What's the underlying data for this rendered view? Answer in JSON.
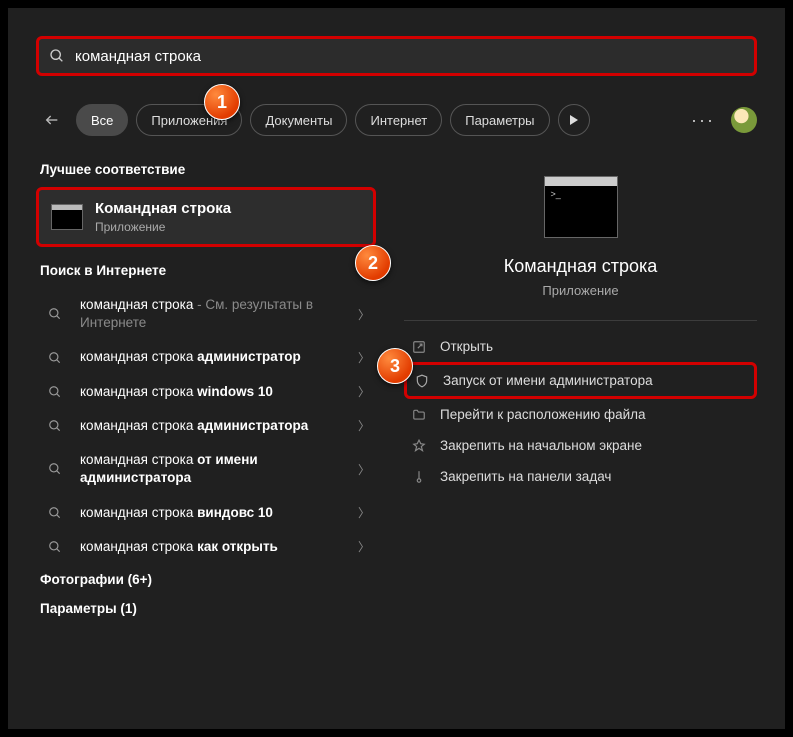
{
  "search": {
    "value": "командная строка"
  },
  "filters": {
    "all": "Все",
    "apps": "Приложения",
    "docs": "Документы",
    "web": "Интернет",
    "settings": "Параметры"
  },
  "sections": {
    "best": "Лучшее соответствие",
    "web": "Поиск в Интернете",
    "photos": "Фотографии (6+)",
    "settings": "Параметры (1)"
  },
  "best_match": {
    "title": "Командная строка",
    "subtitle": "Приложение"
  },
  "web_results": [
    {
      "prefix": "командная строка",
      "bold": "",
      "suffix": " - См. результаты в Интернете"
    },
    {
      "prefix": "командная строка ",
      "bold": "администратор",
      "suffix": ""
    },
    {
      "prefix": "командная строка ",
      "bold": "windows 10",
      "suffix": ""
    },
    {
      "prefix": "командная строка ",
      "bold": "администратора",
      "suffix": ""
    },
    {
      "prefix": "командная строка ",
      "bold": "от имени администратора",
      "suffix": ""
    },
    {
      "prefix": "командная строка ",
      "bold": "виндовс 10",
      "suffix": ""
    },
    {
      "prefix": "командная строка ",
      "bold": "как открыть",
      "suffix": ""
    }
  ],
  "preview": {
    "title": "Командная строка",
    "subtitle": "Приложение",
    "actions": {
      "open": "Открыть",
      "run_admin": "Запуск от имени администратора",
      "open_location": "Перейти к расположению файла",
      "pin_start": "Закрепить на начальном экране",
      "pin_taskbar": "Закрепить на панели задач"
    }
  },
  "badges": {
    "b1": "1",
    "b2": "2",
    "b3": "3"
  }
}
